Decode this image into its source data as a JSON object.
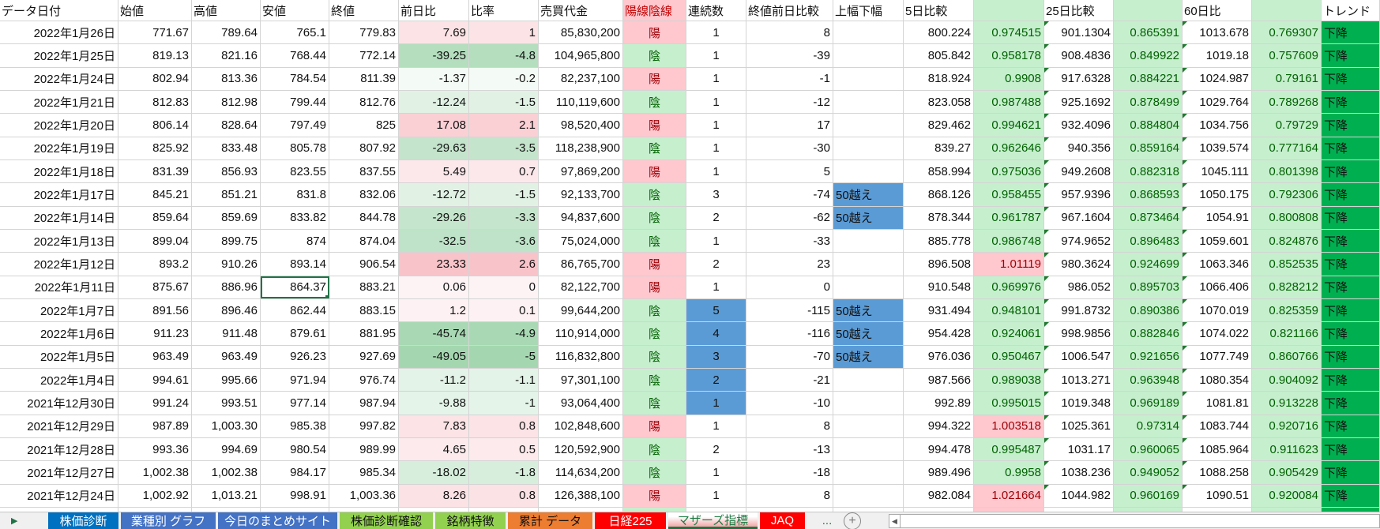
{
  "colors": {
    "yang_bg": "#ffc7ce",
    "yang_text": "#9c0006",
    "yin_bg": "#c6efce",
    "yin_text": "#006100",
    "highlight_blue": "#5b9bd5",
    "trend_bg": "#00b050",
    "ratio_bg": "#c6efce"
  },
  "headers": [
    "データ日付",
    "始値",
    "高値",
    "安値",
    "終値",
    "前日比",
    "比率",
    "売買代金",
    "陽線陰線",
    "連続数",
    "終値前日比較",
    "上幅下幅",
    "5日比較",
    "",
    "25日比較",
    "",
    "60日比",
    "",
    "トレンド"
  ],
  "rows": [
    {
      "cells": [
        "2022年1月26日",
        "771.67",
        "789.64",
        "765.1",
        "779.83",
        "7.69",
        "1",
        "85,830,200",
        "陽",
        "1",
        "8",
        "",
        "800.224",
        "0.974515",
        "901.1304",
        "0.865391",
        "1013.678",
        "0.769307",
        "下降"
      ],
      "streak_highlight": false
    },
    {
      "cells": [
        "2022年1月25日",
        "819.13",
        "821.16",
        "768.44",
        "772.14",
        "-39.25",
        "-4.8",
        "104,965,800",
        "陰",
        "1",
        "-39",
        "",
        "805.842",
        "0.958178",
        "908.4836",
        "0.849922",
        "1019.18",
        "0.757609",
        "下降"
      ],
      "streak_highlight": false
    },
    {
      "cells": [
        "2022年1月24日",
        "802.94",
        "813.36",
        "784.54",
        "811.39",
        "-1.37",
        "-0.2",
        "82,237,100",
        "陽",
        "1",
        "-1",
        "",
        "818.924",
        "0.9908",
        "917.6328",
        "0.884221",
        "1024.987",
        "0.79161",
        "下降"
      ],
      "streak_highlight": false
    },
    {
      "cells": [
        "2022年1月21日",
        "812.83",
        "812.98",
        "799.44",
        "812.76",
        "-12.24",
        "-1.5",
        "110,119,600",
        "陰",
        "1",
        "-12",
        "",
        "823.058",
        "0.987488",
        "925.1692",
        "0.878499",
        "1029.764",
        "0.789268",
        "下降"
      ],
      "streak_highlight": false
    },
    {
      "cells": [
        "2022年1月20日",
        "806.14",
        "828.64",
        "797.49",
        "825",
        "17.08",
        "2.1",
        "98,520,400",
        "陽",
        "1",
        "17",
        "",
        "829.462",
        "0.994621",
        "932.4096",
        "0.884804",
        "1034.756",
        "0.79729",
        "下降"
      ],
      "streak_highlight": false
    },
    {
      "cells": [
        "2022年1月19日",
        "825.92",
        "833.48",
        "805.78",
        "807.92",
        "-29.63",
        "-3.5",
        "118,238,900",
        "陰",
        "1",
        "-30",
        "",
        "839.27",
        "0.962646",
        "940.356",
        "0.859164",
        "1039.574",
        "0.777164",
        "下降"
      ],
      "streak_highlight": false
    },
    {
      "cells": [
        "2022年1月18日",
        "831.39",
        "856.93",
        "823.55",
        "837.55",
        "5.49",
        "0.7",
        "97,869,200",
        "陽",
        "1",
        "5",
        "",
        "858.994",
        "0.975036",
        "949.2608",
        "0.882318",
        "1045.111",
        "0.801398",
        "下降"
      ],
      "streak_highlight": false
    },
    {
      "cells": [
        "2022年1月17日",
        "845.21",
        "851.21",
        "831.8",
        "832.06",
        "-12.72",
        "-1.5",
        "92,133,700",
        "陰",
        "3",
        "-74",
        "50越え",
        "868.126",
        "0.958455",
        "957.9396",
        "0.868593",
        "1050.175",
        "0.792306",
        "下降"
      ],
      "streak_highlight": false
    },
    {
      "cells": [
        "2022年1月14日",
        "859.64",
        "859.69",
        "833.82",
        "844.78",
        "-29.26",
        "-3.3",
        "94,837,600",
        "陰",
        "2",
        "-62",
        "50越え",
        "878.344",
        "0.961787",
        "967.1604",
        "0.873464",
        "1054.91",
        "0.800808",
        "下降"
      ],
      "streak_highlight": false
    },
    {
      "cells": [
        "2022年1月13日",
        "899.04",
        "899.75",
        "874",
        "874.04",
        "-32.5",
        "-3.6",
        "75,024,000",
        "陰",
        "1",
        "-33",
        "",
        "885.778",
        "0.986748",
        "974.9652",
        "0.896483",
        "1059.601",
        "0.824876",
        "下降"
      ],
      "streak_highlight": false
    },
    {
      "cells": [
        "2022年1月12日",
        "893.2",
        "910.26",
        "893.14",
        "906.54",
        "23.33",
        "2.6",
        "86,765,700",
        "陽",
        "2",
        "23",
        "",
        "896.508",
        "1.01119",
        "980.3624",
        "0.924699",
        "1063.346",
        "0.852535",
        "下降"
      ],
      "streak_highlight": false
    },
    {
      "cells": [
        "2022年1月11日",
        "875.67",
        "886.96",
        "864.37",
        "883.21",
        "0.06",
        "0",
        "82,122,700",
        "陽",
        "1",
        "0",
        "",
        "910.548",
        "0.969976",
        "986.052",
        "0.895703",
        "1066.406",
        "0.828212",
        "下降"
      ],
      "streak_highlight": false
    },
    {
      "cells": [
        "2022年1月7日",
        "891.56",
        "896.46",
        "862.44",
        "883.15",
        "1.2",
        "0.1",
        "99,644,200",
        "陰",
        "5",
        "-115",
        "50越え",
        "931.494",
        "0.948101",
        "991.8732",
        "0.890386",
        "1070.019",
        "0.825359",
        "下降"
      ],
      "streak_highlight": true
    },
    {
      "cells": [
        "2022年1月6日",
        "911.23",
        "911.48",
        "879.61",
        "881.95",
        "-45.74",
        "-4.9",
        "110,914,000",
        "陰",
        "4",
        "-116",
        "50越え",
        "954.428",
        "0.924061",
        "998.9856",
        "0.882846",
        "1074.022",
        "0.821166",
        "下降"
      ],
      "streak_highlight": true
    },
    {
      "cells": [
        "2022年1月5日",
        "963.49",
        "963.49",
        "926.23",
        "927.69",
        "-49.05",
        "-5",
        "116,832,800",
        "陰",
        "3",
        "-70",
        "50越え",
        "976.036",
        "0.950467",
        "1006.547",
        "0.921656",
        "1077.749",
        "0.860766",
        "下降"
      ],
      "streak_highlight": true
    },
    {
      "cells": [
        "2022年1月4日",
        "994.61",
        "995.66",
        "971.94",
        "976.74",
        "-11.2",
        "-1.1",
        "97,301,100",
        "陰",
        "2",
        "-21",
        "",
        "987.566",
        "0.989038",
        "1013.271",
        "0.963948",
        "1080.354",
        "0.904092",
        "下降"
      ],
      "streak_highlight": true
    },
    {
      "cells": [
        "2021年12月30日",
        "991.24",
        "993.51",
        "977.14",
        "987.94",
        "-9.88",
        "-1",
        "93,064,400",
        "陰",
        "1",
        "-10",
        "",
        "992.89",
        "0.995015",
        "1019.348",
        "0.969189",
        "1081.81",
        "0.913228",
        "下降"
      ],
      "streak_highlight": true
    },
    {
      "cells": [
        "2021年12月29日",
        "987.89",
        "1,003.30",
        "985.38",
        "997.82",
        "7.83",
        "0.8",
        "102,848,600",
        "陽",
        "1",
        "8",
        "",
        "994.322",
        "1.003518",
        "1025.361",
        "0.97314",
        "1083.744",
        "0.920716",
        "下降"
      ],
      "streak_highlight": false
    },
    {
      "cells": [
        "2021年12月28日",
        "993.36",
        "994.69",
        "980.54",
        "989.99",
        "4.65",
        "0.5",
        "120,592,900",
        "陰",
        "2",
        "-13",
        "",
        "994.478",
        "0.995487",
        "1031.17",
        "0.960065",
        "1085.964",
        "0.911623",
        "下降"
      ],
      "streak_highlight": false
    },
    {
      "cells": [
        "2021年12月27日",
        "1,002.38",
        "1,002.38",
        "984.17",
        "985.34",
        "-18.02",
        "-1.8",
        "114,634,200",
        "陰",
        "1",
        "-18",
        "",
        "989.496",
        "0.9958",
        "1038.236",
        "0.949052",
        "1088.258",
        "0.905429",
        "下降"
      ],
      "streak_highlight": false
    },
    {
      "cells": [
        "2021年12月24日",
        "1,002.92",
        "1,013.21",
        "998.91",
        "1,003.36",
        "8.26",
        "0.8",
        "126,388,100",
        "陽",
        "1",
        "8",
        "",
        "982.084",
        "1.021664",
        "1044.982",
        "0.960169",
        "1090.51",
        "0.920084",
        "下降"
      ],
      "streak_highlight": false
    }
  ],
  "selected_cell": {
    "row": 11,
    "col": 3
  },
  "sheet_tabs": [
    {
      "label": "株価診断",
      "color": "#0070c0",
      "text": "#ffffff"
    },
    {
      "label": "業種別 グラフ",
      "color": "#4472c4",
      "text": "#ffffff"
    },
    {
      "label": "今日のまとめサイト",
      "color": "#4472c4",
      "text": "#ffffff"
    },
    {
      "label": "株価診断確認",
      "color": "#92d050",
      "text": "#111111"
    },
    {
      "label": "銘柄特徴",
      "color": "#92d050",
      "text": "#111111"
    },
    {
      "label": "累計 データ",
      "color": "#ed7d31",
      "text": "#111111"
    },
    {
      "label": "日経225",
      "color": "#ff0000",
      "text": "#ffffff"
    },
    {
      "label": "マザーズ指標",
      "color": "#ffffff",
      "text": "#1e7b45",
      "active": true
    },
    {
      "label": "JAQ",
      "color": "#ff0000",
      "text": "#ffffff"
    }
  ],
  "tab_more": "...",
  "tab_add": "+"
}
